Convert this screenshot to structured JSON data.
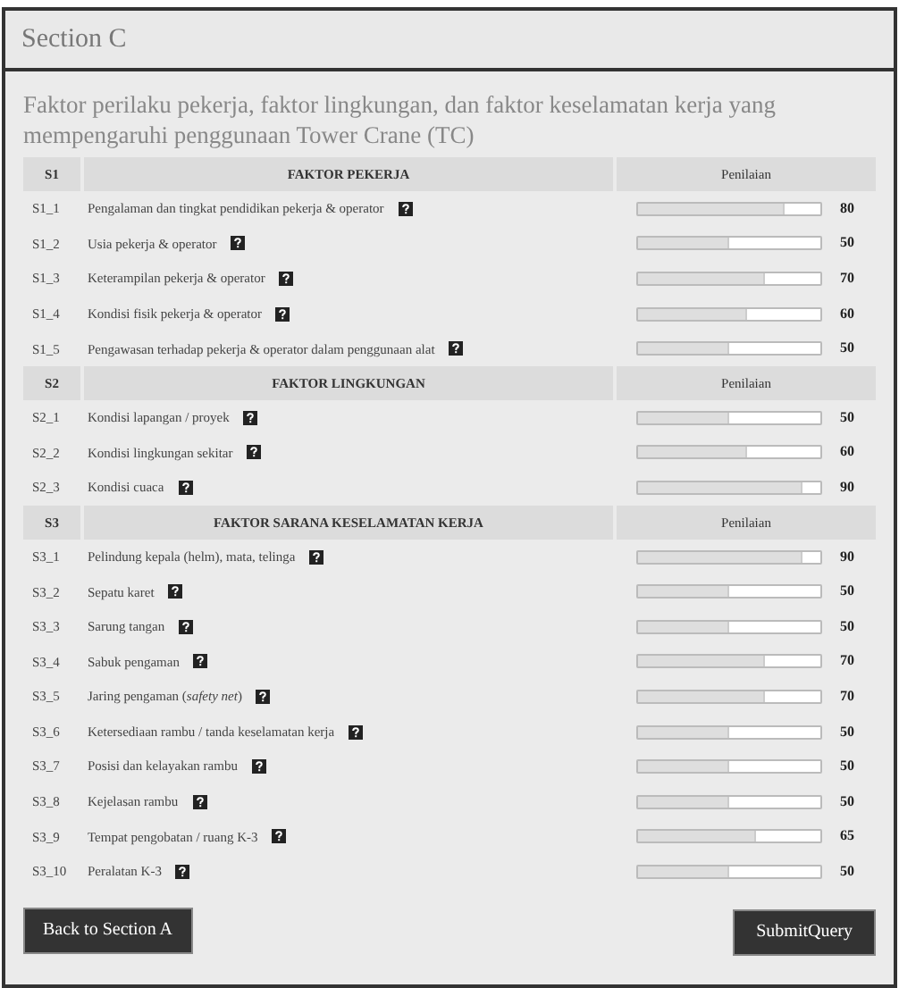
{
  "header": {
    "title": "Section C"
  },
  "heading": "Faktor perilaku pekerja, faktor lingkungan, dan faktor keselamatan kerja yang mempengaruhi penggunaan Tower Crane (TC)",
  "groups": [
    {
      "code": "S1",
      "title": "FAKTOR PEKERJA",
      "rating_header": "Penilaian",
      "items": [
        {
          "code": "S1_1",
          "label": "Pengalaman dan tingkat pendidikan pekerja & operator",
          "level": 0.8,
          "value": "80"
        },
        {
          "code": "S1_2",
          "label": "Usia pekerja & operator",
          "level": 0.5,
          "value": "50"
        },
        {
          "code": "S1_3",
          "label": "Keterampilan pekerja & operator",
          "level": 0.7,
          "value": "70"
        },
        {
          "code": "S1_4",
          "label": "Kondisi fisik pekerja & operator",
          "level": 0.6,
          "value": "60"
        },
        {
          "code": "S1_5",
          "label": "Pengawasan terhadap pekerja & operator dalam penggunaan alat",
          "level": 0.5,
          "value": "50"
        }
      ]
    },
    {
      "code": "S2",
      "title": "FAKTOR LINGKUNGAN",
      "rating_header": "Penilaian",
      "items": [
        {
          "code": "S2_1",
          "label": "Kondisi lapangan / proyek",
          "level": 0.5,
          "value": "50"
        },
        {
          "code": "S2_2",
          "label": "Kondisi lingkungan sekitar",
          "level": 0.6,
          "value": "60"
        },
        {
          "code": "S2_3",
          "label": "Kondisi cuaca",
          "level": 0.9,
          "value": "90"
        }
      ]
    },
    {
      "code": "S3",
      "title": "FAKTOR SARANA KESELAMATAN KERJA",
      "rating_header": "Penilaian",
      "items": [
        {
          "code": "S3_1",
          "label": "Pelindung kepala (helm), mata, telinga",
          "level": 0.9,
          "value": "90"
        },
        {
          "code": "S3_2",
          "label": "Sepatu karet",
          "level": 0.5,
          "value": "50"
        },
        {
          "code": "S3_3",
          "label": "Sarung tangan",
          "level": 0.5,
          "value": "50"
        },
        {
          "code": "S3_4",
          "label": "Sabuk pengaman",
          "level": 0.7,
          "value": "70"
        },
        {
          "code": "S3_5",
          "label": "Jaring pengaman (*safety net*)",
          "level": 0.7,
          "value": "70"
        },
        {
          "code": "S3_6",
          "label": "Ketersediaan rambu / tanda keselamatan kerja",
          "level": 0.5,
          "value": "50"
        },
        {
          "code": "S3_7",
          "label": "Posisi dan kelayakan rambu",
          "level": 0.5,
          "value": "50"
        },
        {
          "code": "S3_8",
          "label": "Kejelasan rambu",
          "level": 0.5,
          "value": "50"
        },
        {
          "code": "S3_9",
          "label": "Tempat pengobatan / ruang K-3",
          "level": 0.65,
          "value": "65"
        },
        {
          "code": "S3_10",
          "label": "Peralatan K-3",
          "level": 0.5,
          "value": "50"
        }
      ]
    }
  ],
  "buttons": [
    {
      "label": "Back to Section A"
    },
    {
      "label": "SubmitQuery"
    }
  ]
}
